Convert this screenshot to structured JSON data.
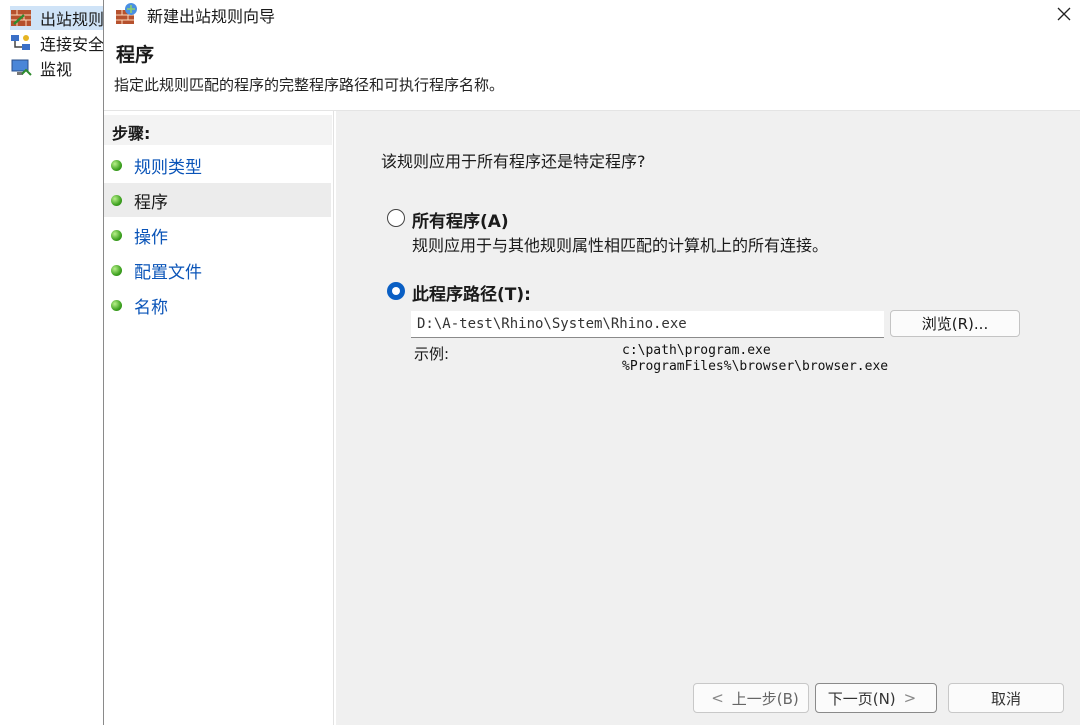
{
  "background_tree": {
    "items": [
      {
        "label": "出站规则",
        "icon": "firewall-outbound-icon"
      },
      {
        "label": "连接安全规则",
        "icon": "connection-security-icon"
      },
      {
        "label": "监视",
        "icon": "monitor-icon"
      }
    ]
  },
  "dialog": {
    "title": "新建出站规则向导",
    "close_glyph": "✕",
    "header": {
      "title": "程序",
      "description": "指定此规则匹配的程序的完整程序路径和可执行程序名称。"
    },
    "steps": {
      "heading": "步骤:",
      "items": [
        {
          "label": "规则类型",
          "current": false
        },
        {
          "label": "程序",
          "current": true
        },
        {
          "label": "操作",
          "current": false
        },
        {
          "label": "配置文件",
          "current": false
        },
        {
          "label": "名称",
          "current": false
        }
      ]
    },
    "content": {
      "question": "该规则应用于所有程序还是特定程序?",
      "option_all": {
        "label": "所有程序(A)",
        "description": "规则应用于与其他规则属性相匹配的计算机上的所有连接。",
        "selected": false
      },
      "option_path": {
        "label": "此程序路径(T):",
        "selected": true,
        "value": "D:\\A-test\\Rhino\\System\\Rhino.exe"
      },
      "browse_label": "浏览(R)...",
      "example_label": "示例:",
      "example_lines": [
        "c:\\path\\program.exe",
        "%ProgramFiles%\\browser\\browser.exe"
      ]
    },
    "buttons": {
      "back": "上一步(B)",
      "next": "下一页(N)",
      "cancel": "取消",
      "back_chevron": "<",
      "next_chevron": ">"
    }
  },
  "colors": {
    "link": "#0a54b8",
    "radio_selected": "#0a5fc4",
    "content_bg": "#f0f0f0",
    "step_dot": "#3fa221"
  }
}
